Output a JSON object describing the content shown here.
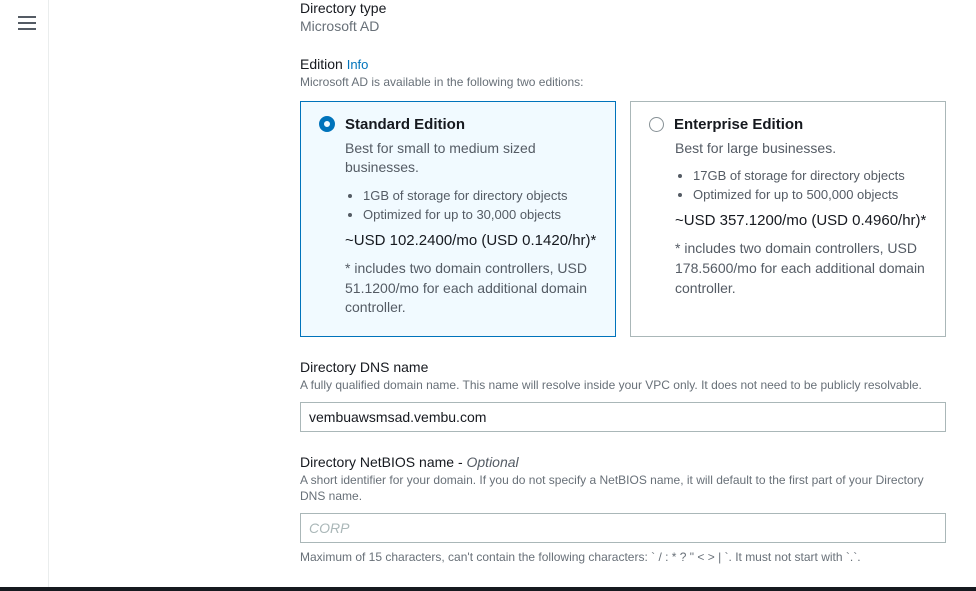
{
  "directoryType": {
    "label": "Directory type",
    "value": "Microsoft AD"
  },
  "edition": {
    "label": "Edition",
    "infoText": "Info",
    "helper": "Microsoft AD is available in the following two editions:",
    "options": [
      {
        "title": "Standard Edition",
        "desc": "Best for small to medium sized businesses.",
        "bullet1": "1GB of storage for directory objects",
        "bullet2": "Optimized for up to 30,000 objects",
        "price": "~USD 102.2400/mo (USD 0.1420/hr)*",
        "note": "* includes two domain controllers, USD 51.1200/mo for each additional domain controller."
      },
      {
        "title": "Enterprise Edition",
        "desc": "Best for large businesses.",
        "bullet1": "17GB of storage for directory objects",
        "bullet2": "Optimized for up to 500,000 objects",
        "price": "~USD 357.1200/mo (USD 0.4960/hr)*",
        "note": "* includes two domain controllers, USD 178.5600/mo for each additional domain controller."
      }
    ]
  },
  "dns": {
    "label": "Directory DNS name",
    "helper": "A fully qualified domain name. This name will resolve inside your VPC only. It does not need to be publicly resolvable.",
    "value": "vembuawsmsad.vembu.com"
  },
  "netbios": {
    "label": "Directory NetBIOS name - ",
    "optional": "Optional",
    "helper": "A short identifier for your domain. If you do not specify a NetBIOS name, it will default to the first part of your Directory DNS name.",
    "placeholder": "CORP",
    "hint": "Maximum of 15 characters, can't contain the following characters: ` / : * ? \" < > | `. It must not start with `.`."
  }
}
